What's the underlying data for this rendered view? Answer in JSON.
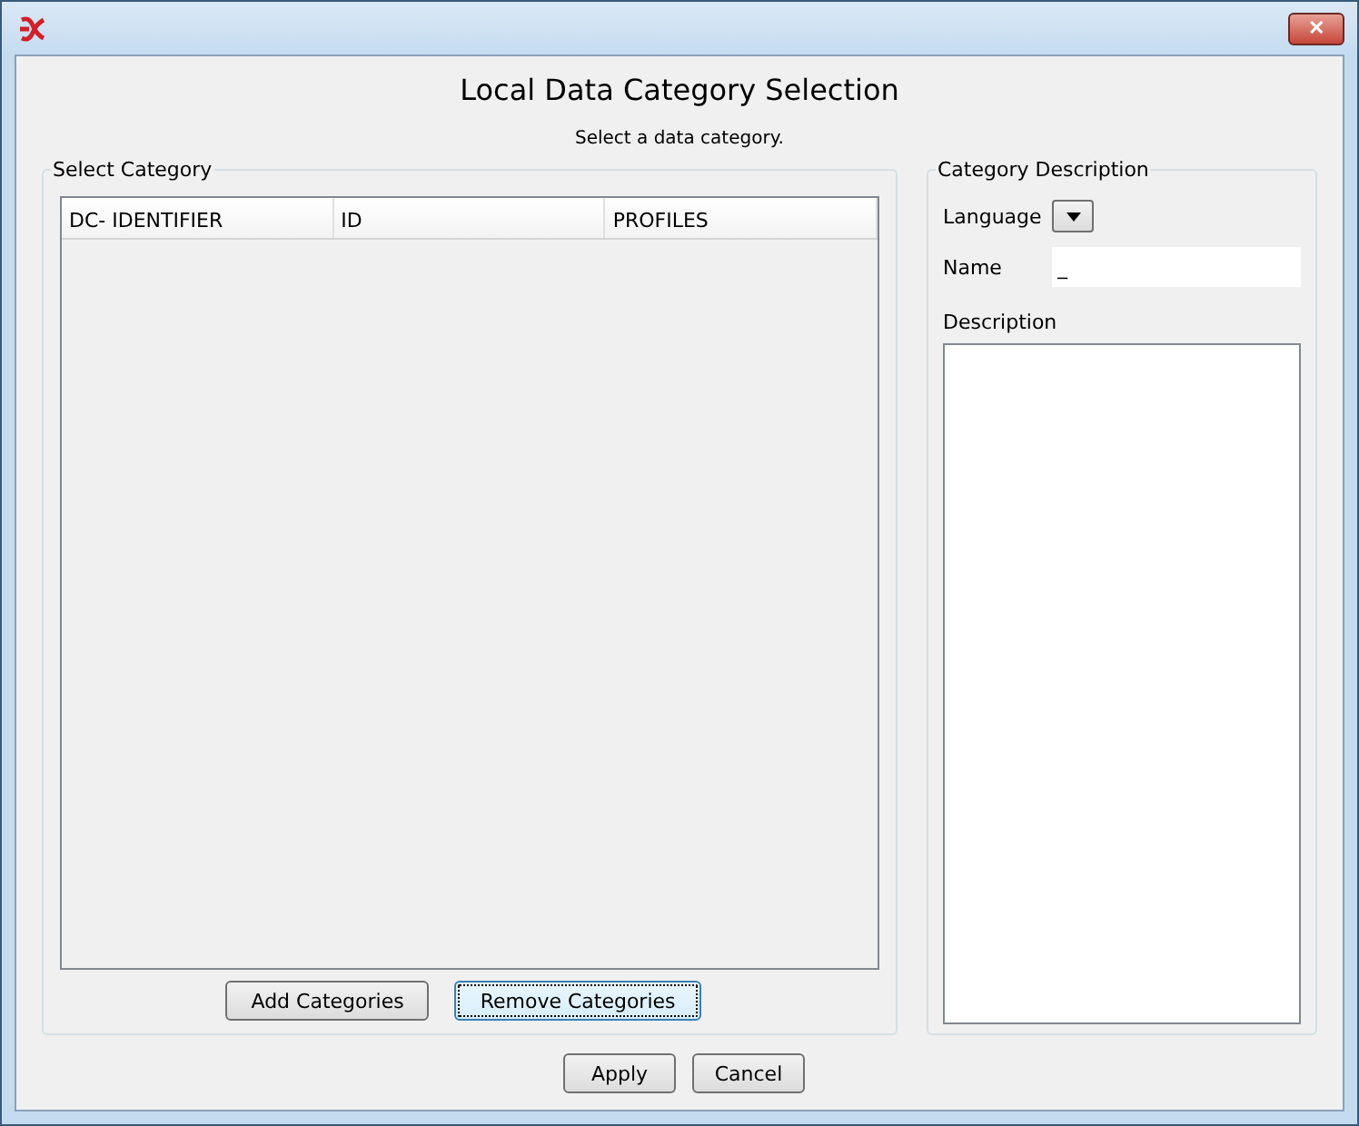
{
  "window": {
    "close": "✕"
  },
  "heading": "Local Data Category Selection",
  "subtitle": "Select a data category.",
  "select_category": {
    "legend": "Select Category",
    "columns": [
      "DC- IDENTIFIER",
      "ID",
      "PROFILES"
    ],
    "buttons": [
      {
        "label": "Add Categories",
        "focused": false
      },
      {
        "label": "Remove Categories",
        "focused": true
      }
    ]
  },
  "category_description": {
    "legend": "Category Description",
    "language_label": "Language",
    "name_label": "Name",
    "name_value": "_",
    "description_label": "Description"
  },
  "buttons": [
    {
      "label": "Apply",
      "focused": false
    },
    {
      "label": "Cancel",
      "focused": false
    }
  ]
}
